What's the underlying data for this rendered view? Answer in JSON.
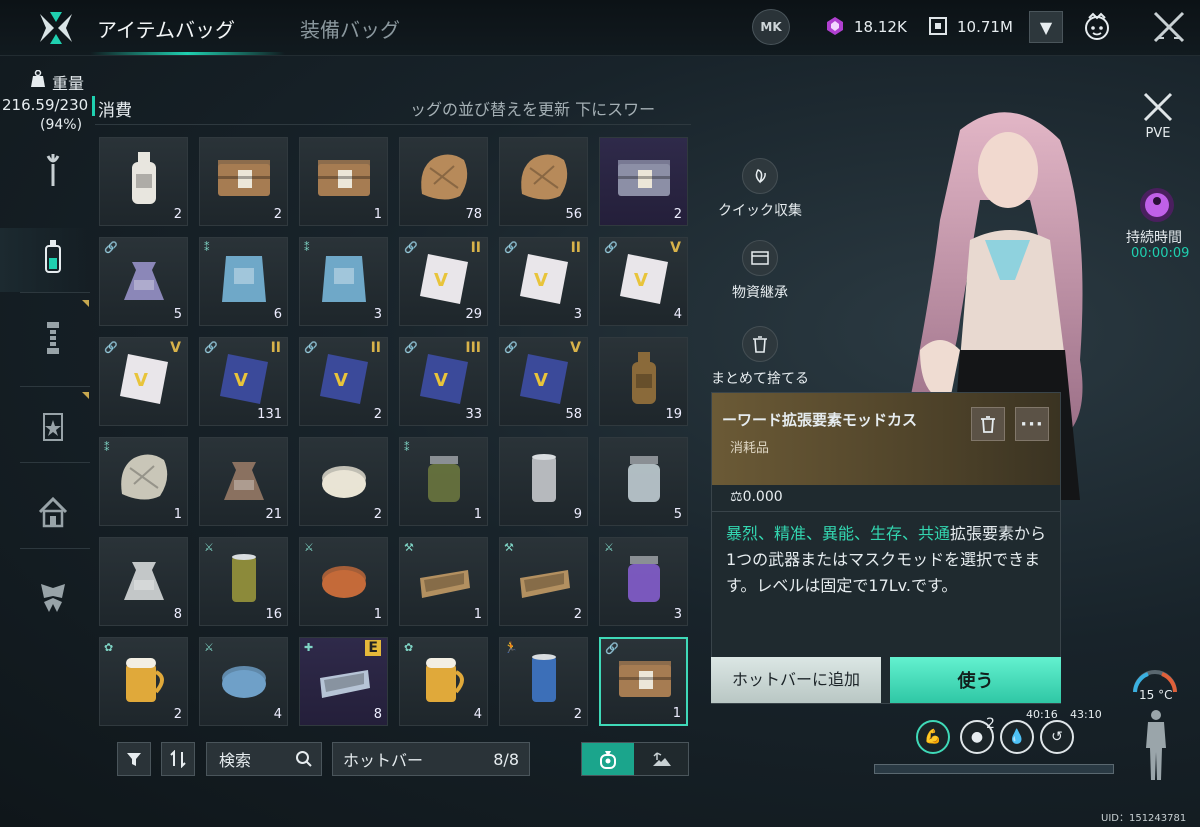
{
  "header": {
    "tabs": [
      "アイテムバッグ",
      "装備バッグ"
    ],
    "mk_label": "MK",
    "currency1": "18.12K",
    "currency2": "10.71M"
  },
  "weight": {
    "label": "重量",
    "value": "216.59/230",
    "percent": "(94%)"
  },
  "category": {
    "title": "消費",
    "marquee": "ッグの並び替えを更新 下にスワー"
  },
  "toolbar": {
    "search_placeholder": "検索",
    "hotbar_label": "ホットバー",
    "hotbar_count": "8/8"
  },
  "sidebuttons": [
    "クイック収集",
    "物資継承",
    "まとめて捨てる"
  ],
  "status": {
    "pve": "PVE",
    "duration_label": "持続時間",
    "duration_value": "00:00:09",
    "temperature": "15 °C"
  },
  "detail": {
    "name": "ーワード拡張要素モッドカス",
    "type": "消耗品",
    "weight": "0.000",
    "desc_highlight": "暴烈、精准、異能、生存、共通",
    "desc_text": "拡張要素から1つの武器またはマスクモッドを選択できます。レベルは固定で17Lv.です。",
    "hotbar_button": "ホットバーに追加",
    "use_button": "使う"
  },
  "skills": {
    "count": "2",
    "timer1": "40:16",
    "timer2": "43:10"
  },
  "footer": {
    "uid": "UID：151243781"
  },
  "items": [
    {
      "name": "milk-bottle",
      "count": "2",
      "art": "bottle",
      "color": "#e8e6df"
    },
    {
      "name": "wooden-crate",
      "count": "2",
      "art": "crate",
      "color": "#a67c52"
    },
    {
      "name": "wooden-crate",
      "count": "1",
      "art": "crate",
      "color": "#a67c52"
    },
    {
      "name": "animal-hide",
      "count": "78",
      "art": "hide",
      "color": "#b78a5a"
    },
    {
      "name": "animal-hide",
      "count": "56",
      "art": "hide",
      "color": "#b78a5a"
    },
    {
      "name": "purple-crate",
      "count": "2",
      "art": "crate",
      "color": "#8c8fa6",
      "purple": true
    },
    {
      "name": "gift-bag",
      "count": "5",
      "art": "bag",
      "color": "#8b87b8",
      "tl": "🔗"
    },
    {
      "name": "blueprint-pack-I",
      "count": "6",
      "art": "pack",
      "color": "#6fa8c8",
      "tl": "⁑"
    },
    {
      "name": "blueprint-pack-IV",
      "count": "3",
      "art": "pack",
      "color": "#6fa8c8",
      "tl": "⁑"
    },
    {
      "name": "v1-card-II",
      "count": "29",
      "art": "card",
      "color": "#e9e6ea",
      "tl": "🔗",
      "tr": "II"
    },
    {
      "name": "v1-card-II",
      "count": "3",
      "art": "card",
      "color": "#e9e6ea",
      "tl": "🔗",
      "tr": "II"
    },
    {
      "name": "v1-card-V",
      "count": "4",
      "art": "card",
      "color": "#e9e6ea",
      "tl": "🔗",
      "tr": "V"
    },
    {
      "name": "v1-card-V",
      "count": "",
      "art": "card",
      "color": "#e9e6ea",
      "tl": "🔗",
      "tr": "V"
    },
    {
      "name": "v2-card-II",
      "count": "131",
      "art": "card",
      "color": "#3b4a9a",
      "tl": "🔗",
      "tr": "II"
    },
    {
      "name": "v2-card-II",
      "count": "2",
      "art": "card",
      "color": "#3b4a9a",
      "tl": "🔗",
      "tr": "II"
    },
    {
      "name": "v2-card-III",
      "count": "33",
      "art": "card",
      "color": "#3b4a9a",
      "tl": "🔗",
      "tr": "III"
    },
    {
      "name": "v2-card-V",
      "count": "58",
      "art": "card",
      "color": "#3b4a9a",
      "tl": "🔗",
      "tr": "V"
    },
    {
      "name": "soda-bottle",
      "count": "19",
      "art": "bottle",
      "color": "#8a6a3a"
    },
    {
      "name": "map-paper",
      "count": "1",
      "art": "hide",
      "color": "#c9c6b8",
      "tl": "⁑"
    },
    {
      "name": "grain-sack",
      "count": "21",
      "art": "bag",
      "color": "#8a7160"
    },
    {
      "name": "cheese",
      "count": "2",
      "art": "round",
      "color": "#e9e4d4"
    },
    {
      "name": "pickle-jar",
      "count": "1",
      "art": "jar",
      "color": "#6f7a3f",
      "tl": "⁑"
    },
    {
      "name": "metal-can",
      "count": "9",
      "art": "can",
      "color": "#b6b9bd"
    },
    {
      "name": "glass-water",
      "count": "5",
      "art": "jar",
      "color": "#c9d6dc"
    },
    {
      "name": "water-pouch",
      "count": "8",
      "art": "bag",
      "color": "#c3c7c8"
    },
    {
      "name": "open-can",
      "count": "16",
      "art": "can",
      "color": "#8c8a3a",
      "tl": "⚔"
    },
    {
      "name": "grilled-skewers",
      "count": "1",
      "art": "round",
      "color": "#c46a3a",
      "tl": "⚔"
    },
    {
      "name": "sardine-tin",
      "count": "1",
      "art": "tin",
      "color": "#b39060",
      "tl": "⚒"
    },
    {
      "name": "sardine-tin",
      "count": "2",
      "art": "tin",
      "color": "#b39060",
      "tl": "⚒"
    },
    {
      "name": "cocktail-glass",
      "count": "3",
      "art": "jar",
      "color": "#8a60d6",
      "tl": "⚔"
    },
    {
      "name": "beer-mug",
      "count": "2",
      "art": "mug",
      "color": "#e0a93a",
      "tl": "✿"
    },
    {
      "name": "blue-cake",
      "count": "4",
      "art": "round",
      "color": "#6fa0c8",
      "tl": "⚔"
    },
    {
      "name": "spam-can",
      "count": "8",
      "art": "tin",
      "color": "#b6c4d6",
      "tl": "✚",
      "tr": "E",
      "purple": true
    },
    {
      "name": "beer-mug",
      "count": "4",
      "art": "mug",
      "color": "#e0a93a",
      "tl": "✿"
    },
    {
      "name": "power-drink",
      "count": "2",
      "art": "can",
      "color": "#3c6fb8",
      "tl": "🏃"
    },
    {
      "name": "selected-crate",
      "count": "1",
      "art": "crate",
      "color": "#a67c52",
      "tl": "🔗",
      "selected": true
    }
  ]
}
